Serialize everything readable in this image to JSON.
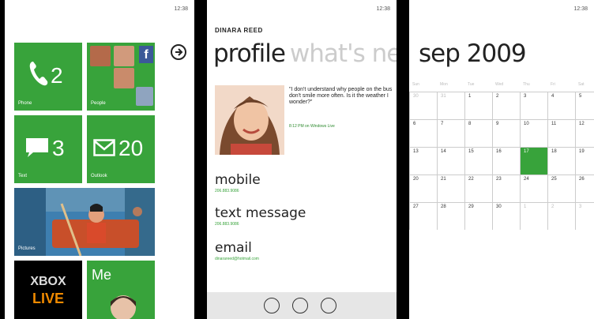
{
  "start": {
    "time": "12:38",
    "tiles": {
      "phone": {
        "label": "Phone",
        "count": "2"
      },
      "people": {
        "label": "People"
      },
      "text": {
        "label": "Text",
        "count": "3"
      },
      "outlook": {
        "label": "Outlook",
        "count": "20"
      },
      "pictures": {
        "label": "Pictures"
      },
      "xbox": {
        "line1": "XBOX",
        "line2": "LIVE"
      },
      "me": {
        "label": "Me"
      }
    }
  },
  "profile": {
    "time": "12:38",
    "contact_name": "DINARA REED",
    "pivot_active": "profile",
    "pivot_next": "what's ne",
    "status": "\"I don't understand why people on the bus don't smile more often. Is it the weather I wonder?\"",
    "status_time": "8:12 PM on Windows Live",
    "rows": {
      "mobile": {
        "label": "mobile",
        "value": "206.883.9086"
      },
      "text": {
        "label": "text message",
        "value": "206.883.9086"
      },
      "email": {
        "label": "email",
        "value": "dinarareed@hotmail.com"
      }
    }
  },
  "calendar": {
    "time": "12:38",
    "title": "sep 2009",
    "weekdays": [
      "Sun",
      "Mon",
      "Tue",
      "Wed",
      "Thu",
      "Fri",
      "Sat"
    ],
    "weeks": [
      [
        "30",
        "31",
        "1",
        "2",
        "3",
        "4",
        "5"
      ],
      [
        "6",
        "7",
        "8",
        "9",
        "10",
        "11",
        "12"
      ],
      [
        "13",
        "14",
        "15",
        "16",
        "17",
        "18",
        "19"
      ],
      [
        "20",
        "21",
        "22",
        "23",
        "24",
        "25",
        "26"
      ],
      [
        "27",
        "28",
        "29",
        "30",
        "1",
        "2",
        "3"
      ]
    ],
    "today": "17"
  },
  "colors": {
    "accent": "#38a33b",
    "xbox_orange": "#f08a00"
  }
}
